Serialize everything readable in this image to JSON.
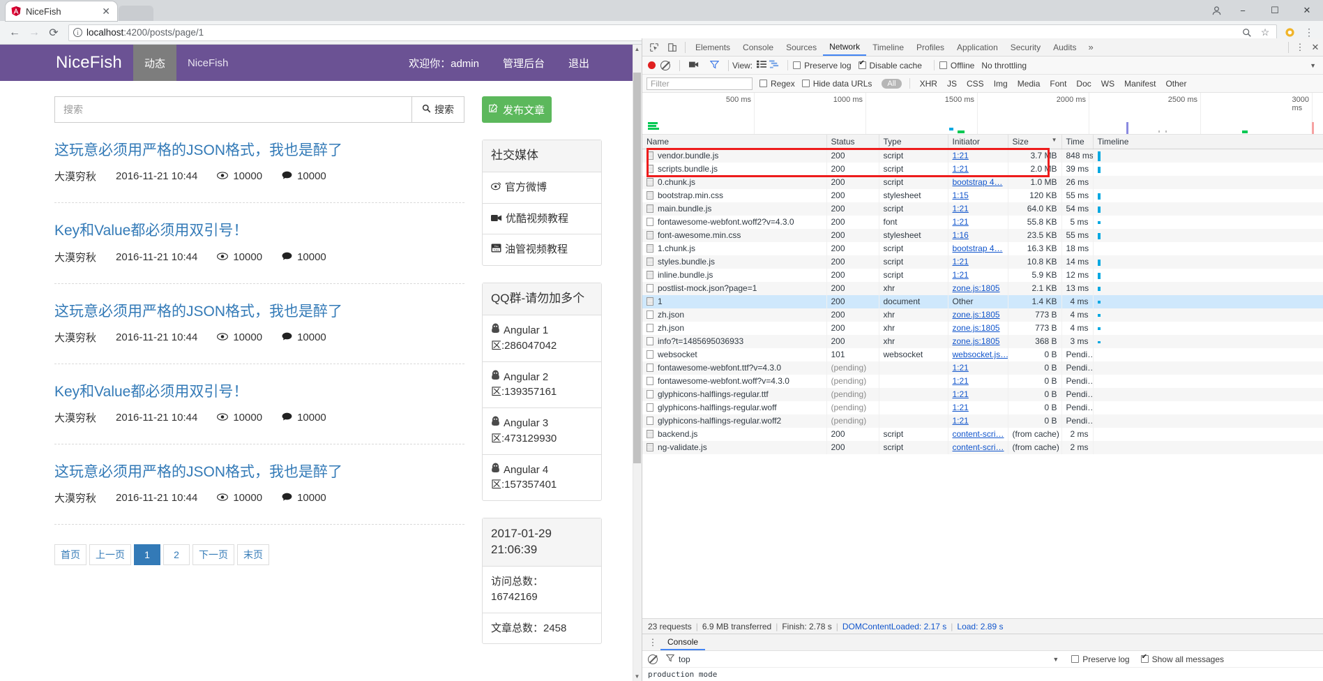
{
  "browser": {
    "tab_title": "NiceFish",
    "tab_close": "✕",
    "url_host": "localhost",
    "url_path": ":4200/posts/page/1",
    "window_minimize": "−",
    "window_maximize": "☐",
    "window_close": "✕"
  },
  "site": {
    "brand": "NiceFish",
    "nav_items": [
      {
        "label": "动态",
        "active": true
      },
      {
        "label": "NiceFish",
        "active": false
      }
    ],
    "welcome": "欢迎你：admin",
    "admin": "管理后台",
    "logout": "退出"
  },
  "search": {
    "placeholder": "搜索",
    "button_label": "搜索"
  },
  "posts": [
    {
      "title": "这玩意必须用严格的JSON格式，我也是醉了",
      "author": "大漠穷秋",
      "date": "2016-11-21 10:44",
      "views": "10000",
      "comments": "10000"
    },
    {
      "title": "Key和Value都必须用双引号！",
      "author": "大漠穷秋",
      "date": "2016-11-21 10:44",
      "views": "10000",
      "comments": "10000"
    },
    {
      "title": "这玩意必须用严格的JSON格式，我也是醉了",
      "author": "大漠穷秋",
      "date": "2016-11-21 10:44",
      "views": "10000",
      "comments": "10000"
    },
    {
      "title": "Key和Value都必须用双引号！",
      "author": "大漠穷秋",
      "date": "2016-11-21 10:44",
      "views": "10000",
      "comments": "10000"
    },
    {
      "title": "这玩意必须用严格的JSON格式，我也是醉了",
      "author": "大漠穷秋",
      "date": "2016-11-21 10:44",
      "views": "10000",
      "comments": "10000"
    }
  ],
  "pager": [
    "首页",
    "上一页",
    "1",
    "2",
    "下一页",
    "末页"
  ],
  "pager_active_index": 2,
  "sidebar": {
    "publish_button": "发布文章",
    "social": {
      "title": "社交媒体",
      "items": [
        {
          "label": "官方微博",
          "icon": "weibo-icon"
        },
        {
          "label": "优酷视频教程",
          "icon": "video-camera-icon"
        },
        {
          "label": "油管视频教程",
          "icon": "youtube-icon"
        }
      ]
    },
    "qq": {
      "title": "QQ群-请勿加多个",
      "groups": [
        {
          "name": "Angular 1",
          "number": "区:286047042"
        },
        {
          "name": "Angular 2",
          "number": "区:139357161"
        },
        {
          "name": "Angular 3",
          "number": "区:473129930"
        },
        {
          "name": "Angular 4",
          "number": "区:157357401"
        }
      ]
    },
    "stats": {
      "datetime": "2017-01-29 21:06:39",
      "visits_label": "访问总数：",
      "visits_value": "16742169",
      "articles_label": "文章总数：2458"
    }
  },
  "devtools": {
    "tabs": [
      "Elements",
      "Console",
      "Sources",
      "Network",
      "Timeline",
      "Profiles",
      "Application",
      "Security",
      "Audits"
    ],
    "active_tab": "Network",
    "more": "»",
    "toolbar": {
      "view_label": "View:",
      "preserve_log": "Preserve log",
      "preserve_log_checked": false,
      "disable_cache": "Disable cache",
      "disable_cache_checked": true,
      "offline": "Offline",
      "offline_checked": false,
      "throttling": "No throttling"
    },
    "filterbar": {
      "filter_placeholder": "Filter",
      "regex": "Regex",
      "hide_data_urls": "Hide data URLs",
      "types": [
        "All",
        "XHR",
        "JS",
        "CSS",
        "Img",
        "Media",
        "Font",
        "Doc",
        "WS",
        "Manifest",
        "Other"
      ],
      "active_type": "All"
    },
    "overview_ticks": [
      "500 ms",
      "1000 ms",
      "1500 ms",
      "2000 ms",
      "2500 ms",
      "3000 ms"
    ],
    "columns": [
      "Name",
      "Status",
      "Type",
      "Initiator",
      "Size",
      "Time",
      "Timeline"
    ],
    "sorted_column": "Size",
    "requests": [
      {
        "name": "vendor.bundle.js",
        "status": "200",
        "type": "script",
        "initiator": "1:21",
        "initiator_link": true,
        "size": "3.7 MB",
        "time": "848 ms",
        "bar": 14,
        "highlight": true,
        "icon": "script-icon"
      },
      {
        "name": "scripts.bundle.js",
        "status": "200",
        "type": "script",
        "initiator": "1:21",
        "initiator_link": true,
        "size": "2.0 MB",
        "time": "39 ms",
        "bar": 9,
        "highlight": true,
        "icon": "script-icon"
      },
      {
        "name": "0.chunk.js",
        "status": "200",
        "type": "script",
        "initiator": "bootstrap 4…",
        "initiator_link": true,
        "size": "1.0 MB",
        "time": "26 ms",
        "bar": 0,
        "icon": "script-icon"
      },
      {
        "name": "bootstrap.min.css",
        "status": "200",
        "type": "stylesheet",
        "initiator": "1:15",
        "initiator_link": true,
        "size": "120 KB",
        "time": "55 ms",
        "bar": 9,
        "icon": "script-icon"
      },
      {
        "name": "main.bundle.js",
        "status": "200",
        "type": "script",
        "initiator": "1:21",
        "initiator_link": true,
        "size": "64.0 KB",
        "time": "54 ms",
        "bar": 9,
        "icon": "script-icon"
      },
      {
        "name": "fontawesome-webfont.woff2?v=4.3.0",
        "status": "200",
        "type": "font",
        "initiator": "1:21",
        "initiator_link": true,
        "size": "55.8 KB",
        "time": "5 ms",
        "bar": 4,
        "icon": "plain-icon"
      },
      {
        "name": "font-awesome.min.css",
        "status": "200",
        "type": "stylesheet",
        "initiator": "1:16",
        "initiator_link": true,
        "size": "23.5 KB",
        "time": "55 ms",
        "bar": 9,
        "icon": "script-icon"
      },
      {
        "name": "1.chunk.js",
        "status": "200",
        "type": "script",
        "initiator": "bootstrap 4…",
        "initiator_link": true,
        "size": "16.3 KB",
        "time": "18 ms",
        "bar": 0,
        "icon": "script-icon"
      },
      {
        "name": "styles.bundle.js",
        "status": "200",
        "type": "script",
        "initiator": "1:21",
        "initiator_link": true,
        "size": "10.8 KB",
        "time": "14 ms",
        "bar": 9,
        "icon": "script-icon"
      },
      {
        "name": "inline.bundle.js",
        "status": "200",
        "type": "script",
        "initiator": "1:21",
        "initiator_link": true,
        "size": "5.9 KB",
        "time": "12 ms",
        "bar": 9,
        "icon": "script-icon"
      },
      {
        "name": "postlist-mock.json?page=1",
        "status": "200",
        "type": "xhr",
        "initiator": "zone.js:1805",
        "initiator_link": true,
        "size": "2.1 KB",
        "time": "13 ms",
        "bar": 6,
        "icon": "plain-icon"
      },
      {
        "name": "1",
        "status": "200",
        "type": "document",
        "initiator": "Other",
        "initiator_link": false,
        "size": "1.4 KB",
        "time": "4 ms",
        "bar": 4,
        "selected": true,
        "icon": "script-icon"
      },
      {
        "name": "zh.json",
        "status": "200",
        "type": "xhr",
        "initiator": "zone.js:1805",
        "initiator_link": true,
        "size": "773 B",
        "time": "4 ms",
        "bar": 4,
        "icon": "plain-icon"
      },
      {
        "name": "zh.json",
        "status": "200",
        "type": "xhr",
        "initiator": "zone.js:1805",
        "initiator_link": true,
        "size": "773 B",
        "time": "4 ms",
        "bar": 4,
        "icon": "plain-icon"
      },
      {
        "name": "info?t=1485695036933",
        "status": "200",
        "type": "xhr",
        "initiator": "zone.js:1805",
        "initiator_link": true,
        "size": "368 B",
        "time": "3 ms",
        "bar": 3,
        "icon": "plain-icon"
      },
      {
        "name": "websocket",
        "status": "101",
        "type": "websocket",
        "initiator": "websocket.js…",
        "initiator_link": true,
        "size": "0 B",
        "time": "Pendi…",
        "bar": 0,
        "icon": "plain-icon"
      },
      {
        "name": "fontawesome-webfont.ttf?v=4.3.0",
        "status": "(pending)",
        "status_muted": true,
        "type": "",
        "initiator": "1:21",
        "initiator_link": true,
        "size": "0 B",
        "time": "Pendi…",
        "bar": 0,
        "icon": "plain-icon"
      },
      {
        "name": "fontawesome-webfont.woff?v=4.3.0",
        "status": "(pending)",
        "status_muted": true,
        "type": "",
        "initiator": "1:21",
        "initiator_link": true,
        "size": "0 B",
        "time": "Pendi…",
        "bar": 0,
        "icon": "plain-icon"
      },
      {
        "name": "glyphicons-halflings-regular.ttf",
        "status": "(pending)",
        "status_muted": true,
        "type": "",
        "initiator": "1:21",
        "initiator_link": true,
        "size": "0 B",
        "time": "Pendi…",
        "bar": 0,
        "icon": "plain-icon"
      },
      {
        "name": "glyphicons-halflings-regular.woff",
        "status": "(pending)",
        "status_muted": true,
        "type": "",
        "initiator": "1:21",
        "initiator_link": true,
        "size": "0 B",
        "time": "Pendi…",
        "bar": 0,
        "icon": "plain-icon"
      },
      {
        "name": "glyphicons-halflings-regular.woff2",
        "status": "(pending)",
        "status_muted": true,
        "type": "",
        "initiator": "1:21",
        "initiator_link": true,
        "size": "0 B",
        "time": "Pendi…",
        "bar": 0,
        "icon": "plain-icon"
      },
      {
        "name": "backend.js",
        "status": "200",
        "type": "script",
        "initiator": "content-scri…",
        "initiator_link": true,
        "size": "(from cache)",
        "time": "2 ms",
        "bar": 0,
        "icon": "script-icon"
      },
      {
        "name": "ng-validate.js",
        "status": "200",
        "type": "script",
        "initiator": "content-scri…",
        "initiator_link": true,
        "size": "(from cache)",
        "time": "2 ms",
        "bar": 0,
        "icon": "script-icon"
      }
    ],
    "status": {
      "requests": "23 requests",
      "transferred": "6.9 MB transferred",
      "finish": "Finish: 2.78 s",
      "dom_content_loaded": "DOMContentLoaded: 2.17 s",
      "load": "Load: 2.89 s"
    },
    "drawer": {
      "tab": "Console",
      "context": "top",
      "preserve_log": "Preserve log",
      "preserve_log_checked": false,
      "show_all": "Show all messages",
      "show_all_checked": true,
      "console_line": "production mode"
    }
  },
  "colors": {
    "brand_purple": "#6b5294",
    "publish_green": "#5cb85c",
    "link_blue": "#337ab7",
    "devtools_accent": "#4285f4",
    "highlight_red": "#ee1c1c",
    "bar_blue": "#00a8e1"
  }
}
